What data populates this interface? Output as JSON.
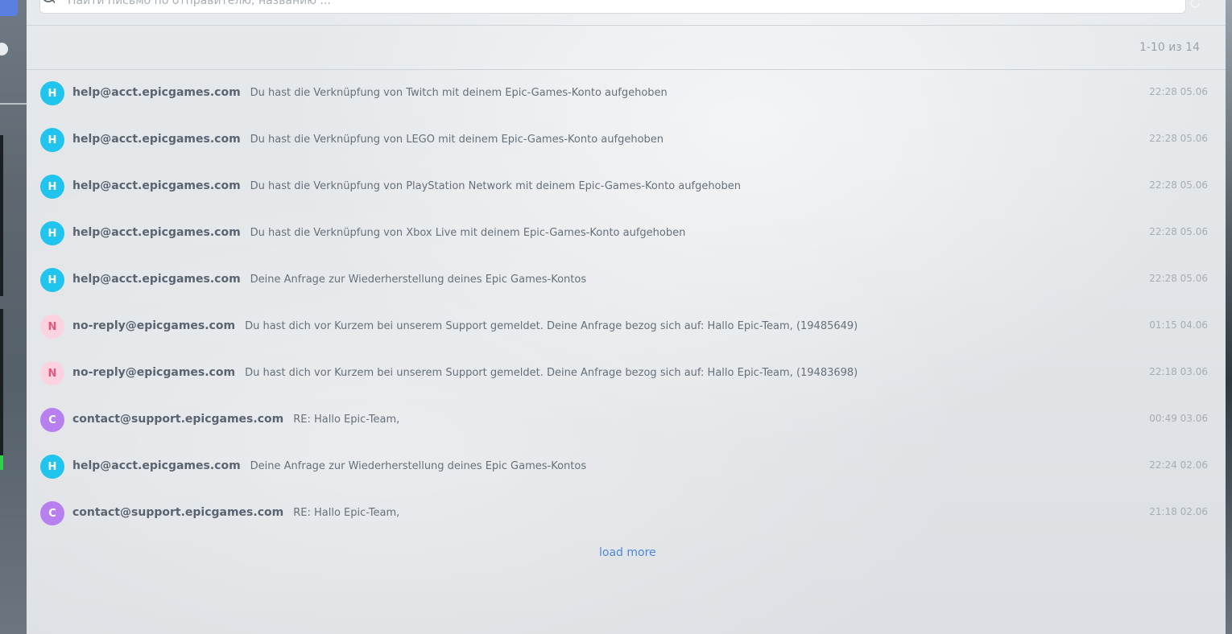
{
  "search": {
    "placeholder": "Найти письмо по отправителю, названию ..."
  },
  "pagination": {
    "label": "1-10 из 14"
  },
  "emails": [
    {
      "initial": "H",
      "sender": "help@acct.epicgames.com",
      "subject": "Du hast die Verknüpfung von Twitch mit deinem Epic-Games-Konto aufgehoben",
      "time": "22:28 05.06",
      "avatar_color": "#20c4ec"
    },
    {
      "initial": "H",
      "sender": "help@acct.epicgames.com",
      "subject": "Du hast die Verknüpfung von LEGO mit deinem Epic-Games-Konto aufgehoben",
      "time": "22:28 05.06",
      "avatar_color": "#20c4ec"
    },
    {
      "initial": "H",
      "sender": "help@acct.epicgames.com",
      "subject": "Du hast die Verknüpfung von PlayStation Network mit deinem Epic-Games-Konto aufgehoben",
      "time": "22:28 05.06",
      "avatar_color": "#20c4ec"
    },
    {
      "initial": "H",
      "sender": "help@acct.epicgames.com",
      "subject": "Du hast die Verknüpfung von Xbox Live mit deinem Epic-Games-Konto aufgehoben",
      "time": "22:28 05.06",
      "avatar_color": "#20c4ec"
    },
    {
      "initial": "H",
      "sender": "help@acct.epicgames.com",
      "subject": "Deine Anfrage zur Wiederherstellung deines Epic Games-Kontos",
      "time": "22:28 05.06",
      "avatar_color": "#20c4ec"
    },
    {
      "initial": "N",
      "sender": "no-reply@epicgames.com",
      "subject": "Du hast dich vor Kurzem bei unserem Support gemeldet. Deine Anfrage bezog sich auf: Hallo Epic-Team, (19485649)",
      "time": "01:15 04.06",
      "avatar_color": "#fbd3e0"
    },
    {
      "initial": "N",
      "sender": "no-reply@epicgames.com",
      "subject": "Du hast dich vor Kurzem bei unserem Support gemeldet. Deine Anfrage bezog sich auf: Hallo Epic-Team, (19483698)",
      "time": "22:18 03.06",
      "avatar_color": "#fbd3e0"
    },
    {
      "initial": "C",
      "sender": "contact@support.epicgames.com",
      "subject": "RE: Hallo Epic-Team,",
      "time": "00:49 03.06",
      "avatar_color": "#b780ee"
    },
    {
      "initial": "H",
      "sender": "help@acct.epicgames.com",
      "subject": "Deine Anfrage zur Wiederherstellung deines Epic Games-Kontos",
      "time": "22:24 02.06",
      "avatar_color": "#20c4ec"
    },
    {
      "initial": "C",
      "sender": "contact@support.epicgames.com",
      "subject": "RE: Hallo Epic-Team,",
      "time": "21:18 02.06",
      "avatar_color": "#b780ee"
    }
  ],
  "load_more": {
    "label": "load more"
  },
  "colors": {
    "accent": "#4f86d9"
  }
}
